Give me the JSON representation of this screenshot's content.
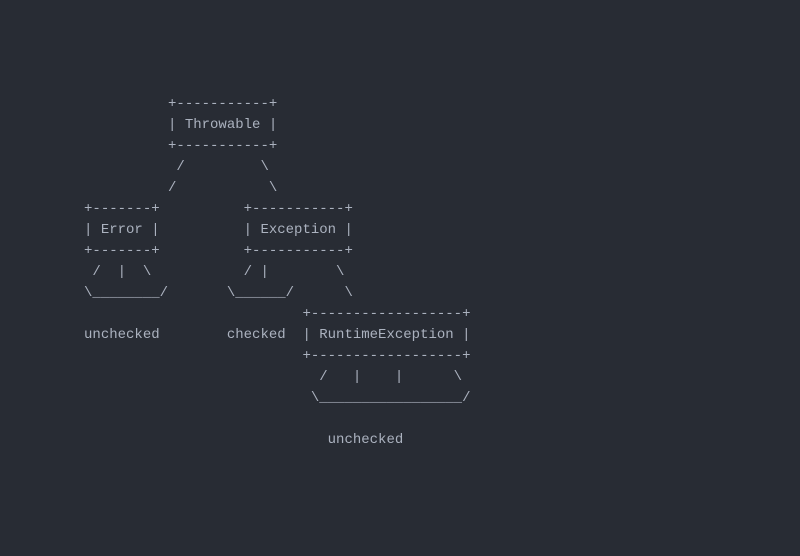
{
  "diagram": {
    "lines": [
      "                    +-----------+",
      "                    | Throwable |",
      "                    +-----------+",
      "                     /         \\",
      "                    /           \\",
      "          +-------+          +-----------+",
      "          | Error |          | Exception |",
      "          +-------+          +-----------+",
      "           /  |  \\           / |        \\",
      "          \\________/       \\______/      \\",
      "                                    +------------------+",
      "          unchecked        checked  | RuntimeException |",
      "                                    +------------------+",
      "                                      /   |    |      \\",
      "                                     \\_________________/",
      "",
      "                                       unchecked"
    ]
  },
  "nodes": {
    "throwable": "Throwable",
    "error": "Error",
    "exception": "Exception",
    "runtimeException": "RuntimeException"
  },
  "labels": {
    "unchecked": "unchecked",
    "checked": "checked"
  }
}
